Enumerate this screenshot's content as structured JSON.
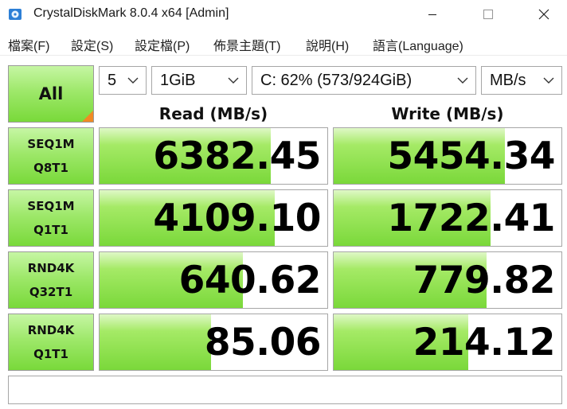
{
  "window": {
    "title": "CrystalDiskMark 8.0.4 x64 [Admin]",
    "icon": "crystaldiskmark-icon",
    "controls": [
      "minimize-icon",
      "maximize-icon",
      "close-icon"
    ]
  },
  "menu": {
    "items": [
      {
        "label": "檔案(F)"
      },
      {
        "label": "設定(S)"
      },
      {
        "label": "設定檔(P)"
      },
      {
        "label": "佈景主題(T)"
      },
      {
        "label": "說明(H)"
      },
      {
        "label": "語言(Language)"
      }
    ]
  },
  "toolbar": {
    "all_label": "All",
    "count": "5",
    "size": "1GiB",
    "drive": "C: 62% (573/924GiB)",
    "unit": "MB/s"
  },
  "headers": {
    "read": "Read (MB/s)",
    "write": "Write (MB/s)"
  },
  "tests": [
    {
      "line1": "SEQ1M",
      "line2": "Q8T1",
      "read": "6382.45",
      "write": "5454.34",
      "read_fill": 0.75,
      "write_fill": 0.75
    },
    {
      "line1": "SEQ1M",
      "line2": "Q1T1",
      "read": "4109.10",
      "write": "1722.41",
      "read_fill": 0.77,
      "write_fill": 0.69
    },
    {
      "line1": "RND4K",
      "line2": "Q32T1",
      "read": "640.62",
      "write": "779.82",
      "read_fill": 0.63,
      "write_fill": 0.67
    },
    {
      "line1": "RND4K",
      "line2": "Q1T1",
      "read": "85.06",
      "write": "214.12",
      "read_fill": 0.49,
      "write_fill": 0.59
    }
  ],
  "colors": {
    "accent_green": "#79d93a",
    "corner_orange": "#f08a24"
  },
  "comment": ""
}
